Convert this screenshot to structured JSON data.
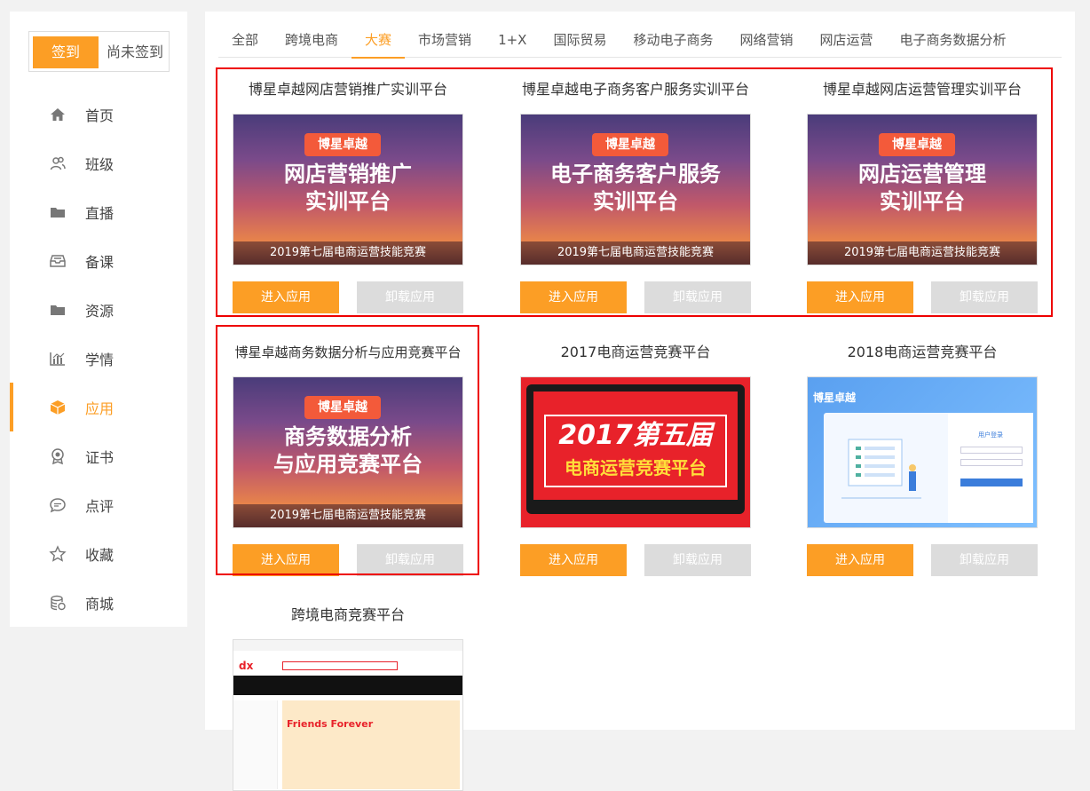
{
  "sidebar": {
    "signin_button": "签到",
    "signin_status": "尚未签到",
    "items": [
      {
        "label": "首页",
        "icon": "home-icon",
        "active": false
      },
      {
        "label": "班级",
        "icon": "users-icon",
        "active": false
      },
      {
        "label": "直播",
        "icon": "folder-icon",
        "active": false
      },
      {
        "label": "备课",
        "icon": "inbox-icon",
        "active": false
      },
      {
        "label": "资源",
        "icon": "folder-icon",
        "active": false
      },
      {
        "label": "学情",
        "icon": "chart-icon",
        "active": false
      },
      {
        "label": "应用",
        "icon": "cube-icon",
        "active": true
      },
      {
        "label": "证书",
        "icon": "award-icon",
        "active": false
      },
      {
        "label": "点评",
        "icon": "comment-icon",
        "active": false
      },
      {
        "label": "收藏",
        "icon": "star-icon",
        "active": false
      },
      {
        "label": "商城",
        "icon": "database-icon",
        "active": false
      }
    ]
  },
  "tabs": [
    "全部",
    "跨境电商",
    "大赛",
    "市场营销",
    "1+X",
    "国际贸易",
    "移动电子商务",
    "网络营销",
    "网店运营",
    "电子商务数据分析"
  ],
  "active_tab": 2,
  "buttons": {
    "enter": "进入应用",
    "uninstall": "卸载应用"
  },
  "apps": [
    {
      "title": "博星卓越网店营销推广实训平台",
      "thumb": {
        "badge": "博星卓越",
        "line1": "网店营销推广",
        "line2": "实训平台",
        "strip": "2019第七届电商运营技能竞赛"
      }
    },
    {
      "title": "博星卓越电子商务客户服务实训平台",
      "thumb": {
        "badge": "博星卓越",
        "line1": "电子商务客户服务",
        "line2": "实训平台",
        "strip": "2019第七届电商运营技能竞赛"
      }
    },
    {
      "title": "博星卓越网店运营管理实训平台",
      "thumb": {
        "badge": "博星卓越",
        "line1": "网店运营管理",
        "line2": "实训平台",
        "strip": "2019第七届电商运营技能竞赛"
      }
    },
    {
      "title": "博星卓越商务数据分析与应用竞赛平台",
      "thumb": {
        "badge": "博星卓越",
        "line1": "商务数据分析",
        "line2": "与应用竞赛平台",
        "strip": "2019第七届电商运营技能竞赛"
      }
    },
    {
      "title": "2017电商运营竞赛平台",
      "thumb": {
        "line1": "2017第五届",
        "line2": "电商运营竞赛平台"
      }
    },
    {
      "title": "2018电商运营竞赛平台",
      "thumb": {
        "brand": "博星卓越",
        "login_title": "用户登录"
      }
    },
    {
      "title": "跨境电商竞赛平台",
      "thumb": {
        "banner": "Friends Forever"
      }
    }
  ],
  "colors": {
    "accent": "#fc9e25",
    "disabled": "#dcdcdc",
    "highlight_border": "#e00000"
  }
}
